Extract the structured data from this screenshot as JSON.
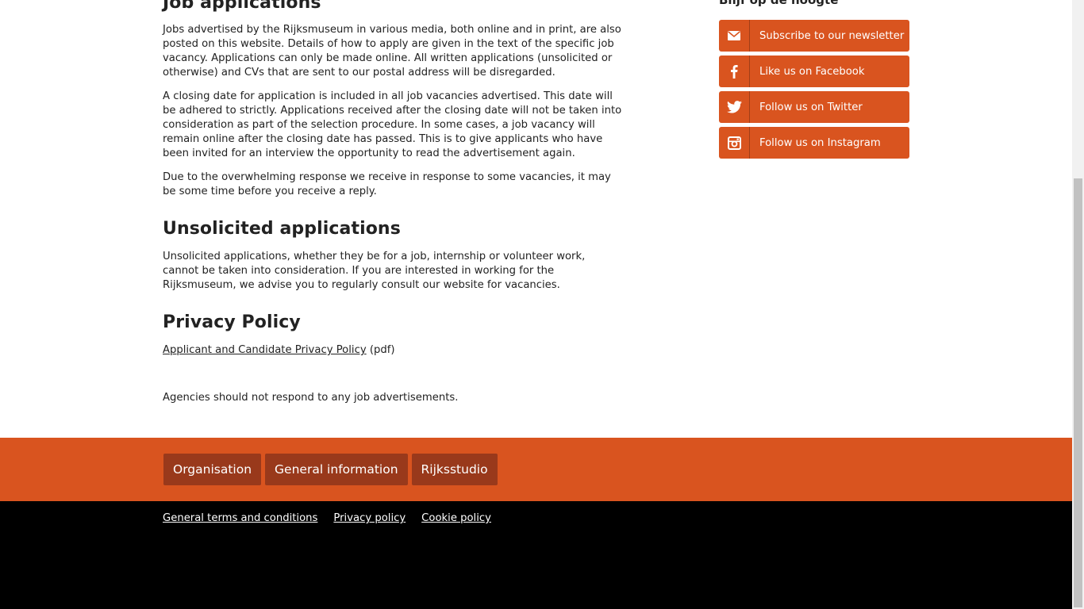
{
  "main": {
    "job_heading": "Job applications",
    "job_p1": "Jobs advertised by the Rijksmuseum in various media, both online and in print, are also posted on this website. Details of how to apply are given in the text of the specific job vacancy. Applications can only be made online. All written applications (unsolicited or otherwise) and CVs that are sent to our postal address will be disregarded.",
    "job_p2": "A closing date for application is included in all job vacancies advertised. This date will be adhered to strictly. Applications received after the closing date will not be taken into consideration as part of the selection procedure. In some cases, a job vacancy will remain online after the closing date has passed. This is to give applicants who have been invited for an interview the opportunity to read the advertisement again.",
    "job_p3": "Due to the overwhelming response we receive in response to some vacancies, it may be some time before you receive a reply.",
    "unsolicited_heading": "Unsolicited applications",
    "unsolicited_p": "Unsolicited applications, whether they be for a job, internship or volunteer work, cannot be taken into consideration. If you are interested in working for the Rijksmuseum, we advise you to regularly consult our website for vacancies.",
    "privacy_heading": "Privacy Policy",
    "privacy_link": "Applicant and Candidate Privacy Policy",
    "privacy_suffix": " (pdf)",
    "agencies_note": "Agencies should not respond to any job advertisements."
  },
  "sidebar": {
    "title": "Blijf op de hoogte",
    "buttons": [
      {
        "label": "Subscribe to our newsletter",
        "icon": "envelope-icon"
      },
      {
        "label": "Like us on Facebook",
        "icon": "facebook-icon"
      },
      {
        "label": "Follow us on Twitter",
        "icon": "twitter-icon"
      },
      {
        "label": "Follow us on Instagram",
        "icon": "instagram-icon"
      }
    ]
  },
  "footer": {
    "nav": [
      "Organisation",
      "General information",
      "Rijksstudio"
    ],
    "legal": [
      "General terms and conditions ",
      "Privacy policy ",
      "Cookie policy"
    ]
  },
  "colors": {
    "accent": "#d9541f",
    "nav_button": "#99391b",
    "footer_bottom": "#000000"
  }
}
